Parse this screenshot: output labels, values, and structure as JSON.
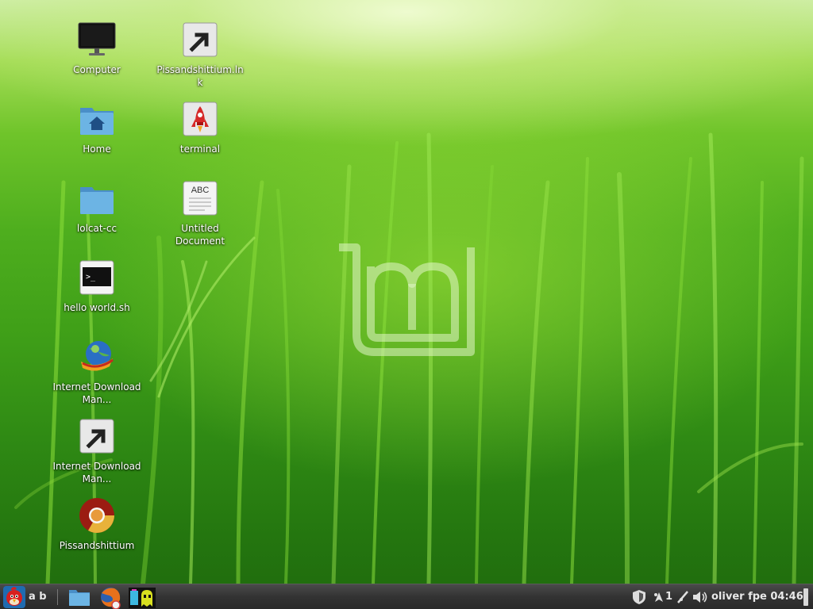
{
  "desktop": {
    "icons": [
      {
        "label": "Computer",
        "icon": "monitor-icon"
      },
      {
        "label": "Pissandshittium.lnk",
        "icon": "shortcut-icon"
      },
      {
        "label": "Home",
        "icon": "home-folder-icon"
      },
      {
        "label": "terminal",
        "icon": "rocket-icon"
      },
      {
        "label": "lolcat-cc",
        "icon": "folder-icon"
      },
      {
        "label": "Untitled Document",
        "icon": "text-document-icon",
        "glyph_text": "ABC"
      },
      {
        "label": "hello world.sh",
        "icon": "terminal-script-icon",
        "glyph_text": ">_"
      },
      {
        "label": "Internet Download Man...",
        "icon": "globe-download-icon"
      },
      {
        "label": "Internet Download Man...",
        "icon": "shortcut-icon"
      },
      {
        "label": "Pissandshittium",
        "icon": "chromium-icon"
      }
    ]
  },
  "taskbar": {
    "menu_icon": "angry-bird-menu-icon",
    "menu_label": "a b",
    "launchers": [
      "files-icon",
      "firefox-icon",
      "pacman-ghost-icon"
    ],
    "tray": {
      "shield_icon": "shield-icon",
      "update_count": "1",
      "clock_text": "oliver fpe 04:46"
    }
  },
  "colors": {
    "label_text": "#ffffff",
    "taskbar_bg": "#333333",
    "folder_blue": "#5aa2d8",
    "chromium_red": "#9b1c12"
  }
}
